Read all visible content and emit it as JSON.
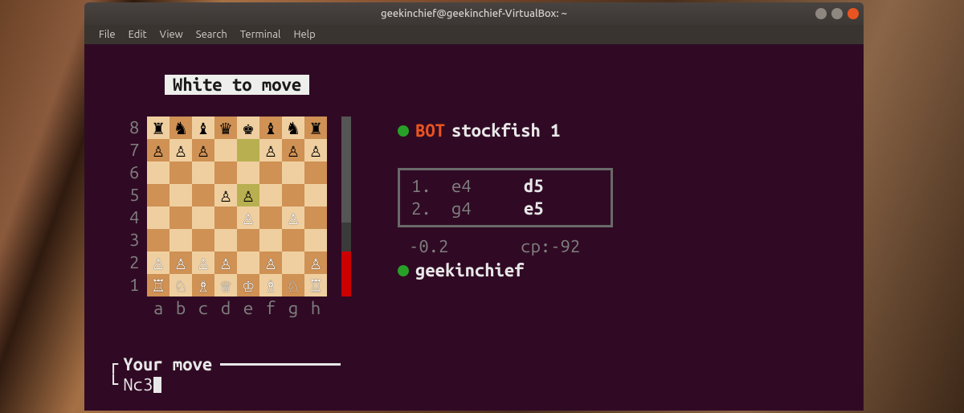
{
  "window": {
    "title": "geekinchief@geekinchief-VirtualBox: ~"
  },
  "menubar": [
    "File",
    "Edit",
    "View",
    "Search",
    "Terminal",
    "Help"
  ],
  "chess": {
    "status": "White to move",
    "ranks": [
      "8",
      "7",
      "6",
      "5",
      "4",
      "3",
      "2",
      "1"
    ],
    "files": [
      "a",
      "b",
      "c",
      "d",
      "e",
      "f",
      "g",
      "h"
    ],
    "board": [
      [
        {
          "p": "♜",
          "c": "b"
        },
        {
          "p": "♞",
          "c": "b"
        },
        {
          "p": "♝",
          "c": "b"
        },
        {
          "p": "♛",
          "c": "b"
        },
        {
          "p": "♚",
          "c": "b"
        },
        {
          "p": "♝",
          "c": "b"
        },
        {
          "p": "♞",
          "c": "b"
        },
        {
          "p": "♜",
          "c": "b"
        }
      ],
      [
        {
          "p": "♙",
          "c": "b"
        },
        {
          "p": "♙",
          "c": "b"
        },
        {
          "p": "♙",
          "c": "b"
        },
        {
          "p": "",
          "c": ""
        },
        {
          "p": "",
          "c": "",
          "hl": true
        },
        {
          "p": "♙",
          "c": "b"
        },
        {
          "p": "♙",
          "c": "b"
        },
        {
          "p": "♙",
          "c": "b"
        }
      ],
      [
        {
          "p": "",
          "c": ""
        },
        {
          "p": "",
          "c": ""
        },
        {
          "p": "",
          "c": ""
        },
        {
          "p": "",
          "c": ""
        },
        {
          "p": "",
          "c": ""
        },
        {
          "p": "",
          "c": ""
        },
        {
          "p": "",
          "c": ""
        },
        {
          "p": "",
          "c": ""
        }
      ],
      [
        {
          "p": "",
          "c": ""
        },
        {
          "p": "",
          "c": ""
        },
        {
          "p": "",
          "c": ""
        },
        {
          "p": "♙",
          "c": "b"
        },
        {
          "p": "♙",
          "c": "b",
          "hl": true
        },
        {
          "p": "",
          "c": ""
        },
        {
          "p": "",
          "c": ""
        },
        {
          "p": "",
          "c": ""
        }
      ],
      [
        {
          "p": "",
          "c": ""
        },
        {
          "p": "",
          "c": ""
        },
        {
          "p": "",
          "c": ""
        },
        {
          "p": "",
          "c": ""
        },
        {
          "p": "♙",
          "c": "w"
        },
        {
          "p": "",
          "c": ""
        },
        {
          "p": "♙",
          "c": "w"
        },
        {
          "p": "",
          "c": ""
        }
      ],
      [
        {
          "p": "",
          "c": ""
        },
        {
          "p": "",
          "c": ""
        },
        {
          "p": "",
          "c": ""
        },
        {
          "p": "",
          "c": ""
        },
        {
          "p": "",
          "c": ""
        },
        {
          "p": "",
          "c": ""
        },
        {
          "p": "",
          "c": ""
        },
        {
          "p": "",
          "c": ""
        }
      ],
      [
        {
          "p": "♙",
          "c": "w"
        },
        {
          "p": "♙",
          "c": "w"
        },
        {
          "p": "♙",
          "c": "w"
        },
        {
          "p": "♙",
          "c": "w"
        },
        {
          "p": "",
          "c": ""
        },
        {
          "p": "♙",
          "c": "w"
        },
        {
          "p": "",
          "c": ""
        },
        {
          "p": "♙",
          "c": "w"
        }
      ],
      [
        {
          "p": "♖",
          "c": "w"
        },
        {
          "p": "♘",
          "c": "w"
        },
        {
          "p": "♗",
          "c": "w"
        },
        {
          "p": "♕",
          "c": "w"
        },
        {
          "p": "♔",
          "c": "w"
        },
        {
          "p": "♗",
          "c": "w"
        },
        {
          "p": "♘",
          "c": "w"
        },
        {
          "p": "♖",
          "c": "w"
        }
      ]
    ]
  },
  "players": {
    "top": {
      "tag": "BOT",
      "name": "stockfish 1"
    },
    "bottom": {
      "name": "geekinchief"
    }
  },
  "moves": [
    {
      "n": "1.",
      "w": "e4",
      "b": "d5"
    },
    {
      "n": "2.",
      "w": "g4",
      "b": "e5"
    }
  ],
  "eval": {
    "score": "-0.2",
    "cp": "cp:-92"
  },
  "input": {
    "label": "Your move",
    "value": "Nc3"
  }
}
